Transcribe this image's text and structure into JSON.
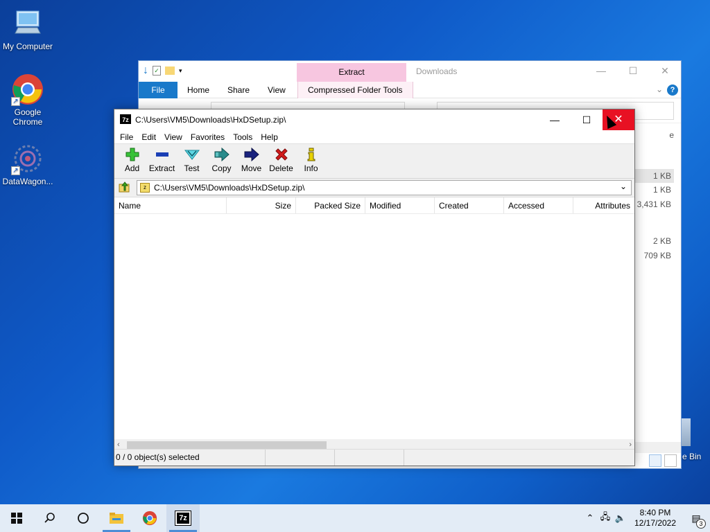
{
  "desktop": {
    "icons": [
      {
        "label": "My Computer"
      },
      {
        "label": "Google Chrome"
      },
      {
        "label": "DataWagon..."
      }
    ],
    "recycle_bin_partial": "e Bin"
  },
  "explorer": {
    "ribbon_context_label": "Extract",
    "title": "Downloads",
    "tabs": [
      "File",
      "Home",
      "Share",
      "View",
      "Compressed Folder Tools"
    ],
    "right_column": [
      "e",
      "1 KB",
      "1 KB",
      "3,431 KB",
      "2 KB",
      "709 KB"
    ]
  },
  "zip": {
    "title": "C:\\Users\\VM5\\Downloads\\HxDSetup.zip\\",
    "app_icon": "7z",
    "controls": {
      "minimize": "—",
      "maximize": "☐",
      "close": "✕"
    },
    "menu": [
      "File",
      "Edit",
      "View",
      "Favorites",
      "Tools",
      "Help"
    ],
    "toolbar": [
      {
        "label": "Add",
        "icon": "plus-icon",
        "color": "#2db82d"
      },
      {
        "label": "Extract",
        "icon": "minus-icon",
        "color": "#1b3fb5"
      },
      {
        "label": "Test",
        "icon": "check-icon",
        "color": "#1fb7c9"
      },
      {
        "label": "Copy",
        "icon": "copy-arrow-icon",
        "color": "#1f7a7a"
      },
      {
        "label": "Move",
        "icon": "move-arrow-icon",
        "color": "#1a237e"
      },
      {
        "label": "Delete",
        "icon": "x-icon",
        "color": "#d11a1a"
      },
      {
        "label": "Info",
        "icon": "info-icon",
        "color": "#9b8a00"
      }
    ],
    "path": "C:\\Users\\VM5\\Downloads\\HxDSetup.zip\\",
    "columns": [
      "Name",
      "Size",
      "Packed Size",
      "Modified",
      "Created",
      "Accessed",
      "Attributes"
    ],
    "status": "0 / 0 object(s) selected"
  },
  "taskbar": {
    "time": "8:40 PM",
    "date": "12/17/2022",
    "notifications": "3"
  }
}
